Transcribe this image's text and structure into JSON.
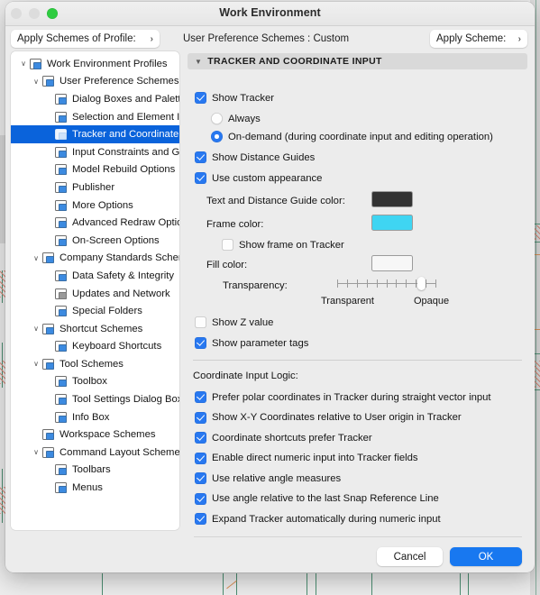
{
  "window": {
    "title": "Work Environment",
    "traffic_lights": [
      "close-disabled",
      "minimize-disabled",
      "zoom-green"
    ]
  },
  "scheme_bar": {
    "profile_button": "Apply Schemes of Profile:",
    "profile_chevron": "›",
    "current_scheme_label": "User Preference Schemes :  Custom",
    "apply_button": "Apply Scheme:",
    "apply_chevron": "›"
  },
  "sidebar": {
    "items": [
      {
        "label": "Work Environment Profiles",
        "depth": 0,
        "twisty": "∨",
        "icon": "monitor-profile-icon",
        "selected": false
      },
      {
        "label": "User Preference Schemes",
        "depth": 1,
        "twisty": "∨",
        "icon": "user-preference-icon",
        "selected": false
      },
      {
        "label": "Dialog Boxes and Palettes",
        "depth": 2,
        "twisty": "",
        "icon": "dialog-boxes-icon",
        "selected": false
      },
      {
        "label": "Selection and Element Informatic",
        "depth": 2,
        "twisty": "",
        "icon": "selection-info-icon",
        "selected": false
      },
      {
        "label": "Tracker and Coordinate Input",
        "depth": 2,
        "twisty": "",
        "icon": "tracker-xyz-icon",
        "selected": true
      },
      {
        "label": "Input Constraints and Guides",
        "depth": 2,
        "twisty": "",
        "icon": "input-constraints-icon",
        "selected": false
      },
      {
        "label": "Model Rebuild Options",
        "depth": 2,
        "twisty": "",
        "icon": "model-rebuild-icon",
        "selected": false
      },
      {
        "label": "Publisher",
        "depth": 2,
        "twisty": "",
        "icon": "publisher-icon",
        "selected": false
      },
      {
        "label": "More Options",
        "depth": 2,
        "twisty": "",
        "icon": "more-options-icon",
        "selected": false
      },
      {
        "label": "Advanced Redraw Options",
        "depth": 2,
        "twisty": "",
        "icon": "advanced-redraw-icon",
        "selected": false
      },
      {
        "label": "On-Screen Options",
        "depth": 2,
        "twisty": "",
        "icon": "on-screen-icon",
        "selected": false
      },
      {
        "label": "Company Standards Schemes",
        "depth": 1,
        "twisty": "∨",
        "icon": "company-standards-icon",
        "selected": false
      },
      {
        "label": "Data Safety & Integrity",
        "depth": 2,
        "twisty": "",
        "icon": "data-safety-icon",
        "selected": false
      },
      {
        "label": "Updates and Network",
        "depth": 2,
        "twisty": "",
        "icon": "globe-icon",
        "selected": false
      },
      {
        "label": "Special Folders",
        "depth": 2,
        "twisty": "",
        "icon": "special-folders-icon",
        "selected": false
      },
      {
        "label": "Shortcut Schemes",
        "depth": 1,
        "twisty": "∨",
        "icon": "shortcut-schemes-icon",
        "selected": false
      },
      {
        "label": "Keyboard Shortcuts",
        "depth": 2,
        "twisty": "",
        "icon": "keyboard-shortcuts-icon",
        "selected": false
      },
      {
        "label": "Tool Schemes",
        "depth": 1,
        "twisty": "∨",
        "icon": "tool-schemes-icon",
        "selected": false
      },
      {
        "label": "Toolbox",
        "depth": 2,
        "twisty": "",
        "icon": "toolbox-icon",
        "selected": false
      },
      {
        "label": "Tool Settings Dialog Boxes",
        "depth": 2,
        "twisty": "",
        "icon": "tool-settings-icon",
        "selected": false
      },
      {
        "label": "Info Box",
        "depth": 2,
        "twisty": "",
        "icon": "info-box-icon",
        "selected": false
      },
      {
        "label": "Workspace Schemes",
        "depth": 1,
        "twisty": "",
        "icon": "workspace-schemes-icon",
        "selected": false
      },
      {
        "label": "Command Layout Schemes",
        "depth": 1,
        "twisty": "∨",
        "icon": "command-layout-icon",
        "selected": false
      },
      {
        "label": "Toolbars",
        "depth": 2,
        "twisty": "",
        "icon": "toolbars-icon",
        "selected": false
      },
      {
        "label": "Menus",
        "depth": 2,
        "twisty": "",
        "icon": "menus-icon",
        "selected": false
      }
    ]
  },
  "panel": {
    "section_title": "TRACKER AND COORDINATE INPUT",
    "section_triangle": "▼",
    "show_tracker": "Show Tracker",
    "radio_always": "Always",
    "radio_on_demand": "On-demand (during coordinate input and editing operation)",
    "show_distance_guides": "Show Distance Guides",
    "use_custom_appearance": "Use custom appearance",
    "text_guide_color_label": "Text and Distance Guide color:",
    "frame_color_label": "Frame color:",
    "show_frame_on_tracker": "Show frame on Tracker",
    "fill_color_label": "Fill color:",
    "transparency_label": "Transparency:",
    "transparent_label": "Transparent",
    "opaque_label": "Opaque",
    "show_z_value": "Show Z value",
    "show_parameter_tags": "Show parameter tags",
    "coordinate_input_logic": "Coordinate Input Logic:",
    "logic_options": [
      "Prefer polar coordinates in Tracker during straight vector input",
      "Show X-Y Coordinates relative to User origin in Tracker",
      "Coordinate shortcuts prefer Tracker",
      "Enable direct numeric input into Tracker fields",
      "Use relative angle measures",
      "Use angle relative to the last Snap Reference Line",
      "Expand Tracker automatically during numeric input"
    ],
    "transparency_percent": 88,
    "colors": {
      "text_guide": "#333333",
      "frame": "#3FD5F2",
      "fill": "#F7F7F7",
      "accent": "#2878F0",
      "selection": "#0A63DB"
    }
  },
  "footer": {
    "cancel": "Cancel",
    "ok": "OK"
  }
}
